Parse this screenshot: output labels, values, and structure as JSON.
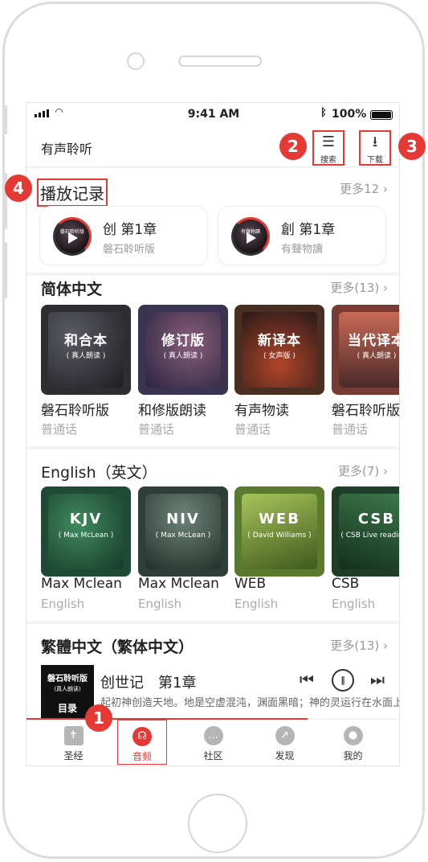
{
  "status_bar": {
    "time": "9:41 AM",
    "battery": "100%"
  },
  "header": {
    "title": "有声聆听",
    "search_label": "搜索",
    "download_label": "下载"
  },
  "play_history": {
    "title": "播放记录",
    "more": "更多12",
    "items": [
      {
        "title": "创 第1章",
        "subtitle": "磐石聆听版",
        "thumb_label": "磐石聆听版"
      },
      {
        "title": "創 第1章",
        "subtitle": "有聲物讀",
        "thumb_label": "有聲物讀"
      }
    ]
  },
  "simplified": {
    "title": "简体中文",
    "more": "更多(13)",
    "items": [
      {
        "cover_title": "和合本",
        "cover_sub": "( 真人朗读 )",
        "name": "磐石聆听版",
        "lang": "普通话"
      },
      {
        "cover_title": "修订版",
        "cover_sub": "( 真人朗读 )",
        "name": "和修版朗读",
        "lang": "普通话"
      },
      {
        "cover_title": "新译本",
        "cover_sub": "( 女声版 )",
        "name": "有声物读",
        "lang": "普通话"
      },
      {
        "cover_title": "当代译本",
        "cover_sub": "( 真人朗读 )",
        "name": "磐石聆听版",
        "lang": "普通话"
      }
    ]
  },
  "english": {
    "title": "English（英文）",
    "more": "更多(7)",
    "items": [
      {
        "cover_title": "KJV",
        "cover_sub": "( Max McLean )",
        "name": "Max Mclean",
        "lang": "English"
      },
      {
        "cover_title": "NIV",
        "cover_sub": "( Max McLean )",
        "name": "Max Mclean",
        "lang": "English"
      },
      {
        "cover_title": "WEB",
        "cover_sub": "( David Williams )",
        "name": "WEB",
        "lang": "English"
      },
      {
        "cover_title": "CSB",
        "cover_sub": "( CSB Live reading )",
        "name": "CSB",
        "lang": "English"
      }
    ]
  },
  "traditional": {
    "title": "繁體中文（繁体中文）",
    "more": "更多(13)"
  },
  "player": {
    "cover_line1": "磐石聆听版",
    "cover_line2": "(真人朗读)",
    "cover_line3": "目录",
    "title": "创世记　第1章",
    "subtitle": "起初神创造天地。地是空虚混沌，渊面黑暗；神的灵运行在水面上"
  },
  "tabs": [
    {
      "label": "圣经",
      "icon": "bible-book-icon"
    },
    {
      "label": "音频",
      "icon": "headphones-icon",
      "active": true
    },
    {
      "label": "社区",
      "icon": "chat-bubbles-icon"
    },
    {
      "label": "发现",
      "icon": "compass-icon"
    },
    {
      "label": "我的",
      "icon": "user-profile-icon"
    }
  ],
  "annotations": [
    "1",
    "2",
    "3",
    "4"
  ],
  "colors": {
    "accent": "#e53935",
    "muted": "#999999"
  }
}
